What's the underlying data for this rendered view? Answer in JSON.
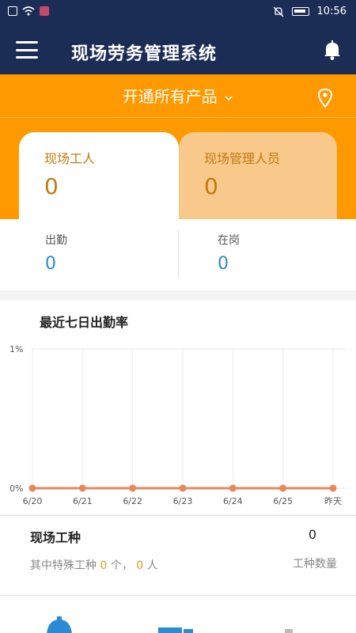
{
  "status_bar": {
    "time": "10:56"
  },
  "header": {
    "title": "现场劳务管理系统"
  },
  "product_selector": {
    "label": "开通所有产品"
  },
  "tabs": [
    {
      "label": "现场工人",
      "value": "0"
    },
    {
      "label": "现场管理人员",
      "value": "0"
    }
  ],
  "attendance": {
    "present": {
      "label": "出勤",
      "value": "0"
    },
    "on_post": {
      "label": "在岗",
      "value": "0"
    }
  },
  "chart_section": {
    "title": "最近七日出勤率"
  },
  "chart_data": {
    "type": "line",
    "title": "最近七日出勤率",
    "categories": [
      "6/20",
      "6/21",
      "6/22",
      "6/23",
      "6/24",
      "6/25",
      "昨天"
    ],
    "series": [
      {
        "values": [
          0,
          0,
          0,
          0,
          0,
          0,
          0
        ]
      }
    ],
    "y_ticks": [
      "1%",
      "0%"
    ],
    "ylim": [
      0,
      1
    ],
    "grid": true,
    "line_color": "#e8875a"
  },
  "work_types": {
    "title": "现场工种",
    "count": "0",
    "count_label": "工种数量",
    "special_prefix": "其中特殊工种",
    "special_types": "0",
    "special_types_unit": "个，",
    "special_people": "0",
    "special_people_unit": "人"
  },
  "colors": {
    "header": "#1c2d55",
    "accent": "#ff9900",
    "value_blue": "#2a8ad4"
  }
}
